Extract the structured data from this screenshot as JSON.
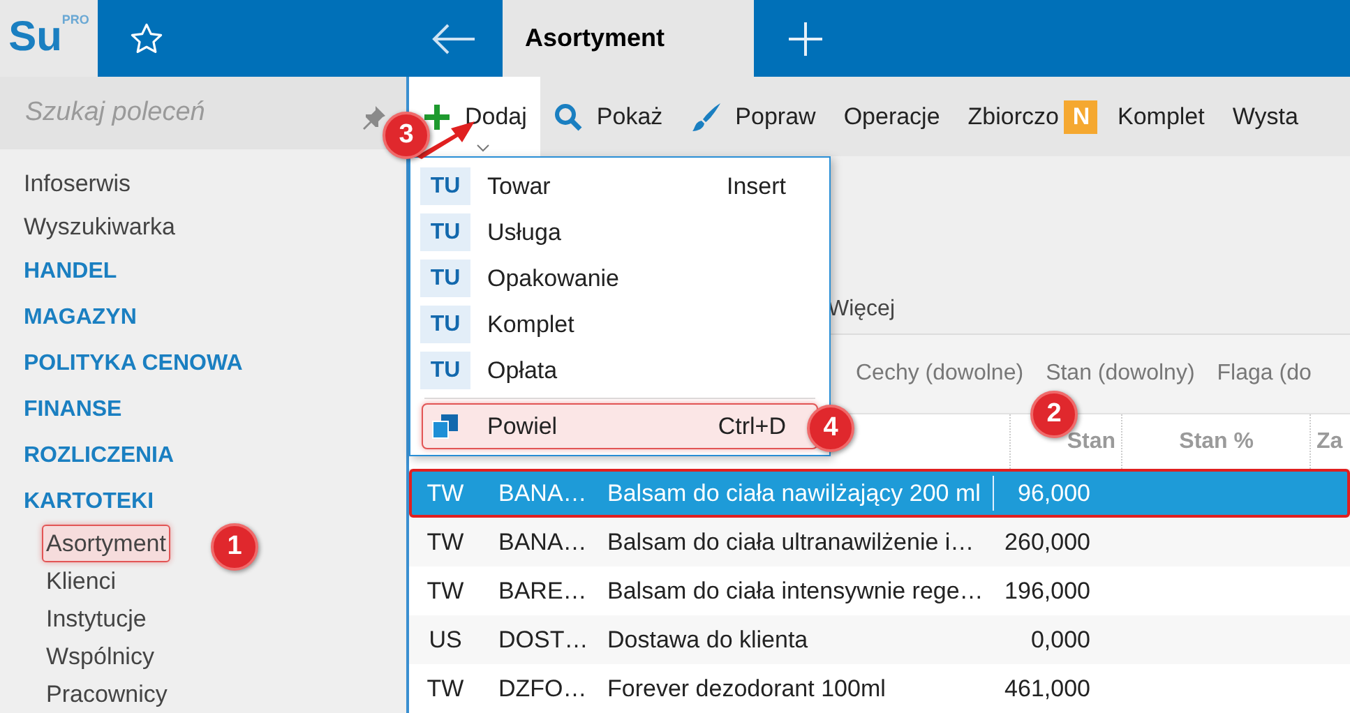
{
  "app": {
    "logo": "Su",
    "logo_badge": "PRO"
  },
  "tabs": [
    {
      "label": "Asortyment",
      "selected": true
    }
  ],
  "sidebar": {
    "search": {
      "placeholder": "Szukaj poleceń"
    },
    "items": [
      {
        "label": "Infoserwis",
        "kind": "link"
      },
      {
        "label": "Wyszukiwarka",
        "kind": "link"
      },
      {
        "label": "HANDEL",
        "kind": "section"
      },
      {
        "label": "MAGAZYN",
        "kind": "section"
      },
      {
        "label": "POLITYKA CENOWA",
        "kind": "section"
      },
      {
        "label": "FINANSE",
        "kind": "section"
      },
      {
        "label": "ROZLICZENIA",
        "kind": "section"
      },
      {
        "label": "KARTOTEKI",
        "kind": "section",
        "children": [
          {
            "label": "Asortyment",
            "selected": true
          },
          {
            "label": "Klienci",
            "selected": false
          },
          {
            "label": "Instytucje",
            "selected": false
          },
          {
            "label": "Wspólnicy",
            "selected": false
          },
          {
            "label": "Pracownicy",
            "selected": false
          }
        ]
      }
    ]
  },
  "toolbar": [
    {
      "label": "Dodaj",
      "kind": "add",
      "expanded": true
    },
    {
      "label": "Pokaż",
      "kind": "show",
      "expanded": false
    },
    {
      "label": "Popraw",
      "kind": "edit",
      "expanded": false
    },
    {
      "label": "Operacje",
      "kind": "plain",
      "expanded": false
    },
    {
      "label": "Zbiorczo",
      "kind": "plain",
      "badge": "N",
      "expanded": false
    },
    {
      "label": "Komplet",
      "kind": "plain",
      "expanded": false
    },
    {
      "label": "Wysta",
      "kind": "plain",
      "expanded": false
    }
  ],
  "more_label": "Więcej",
  "filters": [
    "Cechy (dowolne)",
    "Stan (dowolny)",
    "Flaga (do"
  ],
  "table": {
    "columns": [
      "Stan",
      "Stan %",
      "Za"
    ],
    "rows": [
      {
        "cells": [
          "TW",
          "BANA…",
          "Balsam do ciała nawilżający 200 ml",
          "96,000"
        ],
        "selected": true
      },
      {
        "cells": [
          "TW",
          "BANA…",
          "Balsam do ciała ultranawilżenie i…",
          "260,000"
        ],
        "selected": false
      },
      {
        "cells": [
          "TW",
          "BARE…",
          "Balsam do ciała intensywnie rege…",
          "196,000"
        ],
        "selected": false
      },
      {
        "cells": [
          "US",
          "DOST…",
          "Dostawa do klienta",
          "0,000"
        ],
        "selected": false
      },
      {
        "cells": [
          "TW",
          "DZFO…",
          "Forever dezodorant 100ml",
          "461,000"
        ],
        "selected": false
      }
    ]
  },
  "menu": {
    "items": [
      {
        "kind": "type",
        "icon_text": "TU",
        "label": "Towar",
        "shortcut": "Insert",
        "highlighted": false
      },
      {
        "kind": "type",
        "icon_text": "TU",
        "label": "Usługa",
        "highlighted": false
      },
      {
        "kind": "type",
        "icon_text": "TU",
        "label": "Opakowanie",
        "highlighted": false
      },
      {
        "kind": "type",
        "icon_text": "TU",
        "label": "Komplet",
        "highlighted": false
      },
      {
        "kind": "type",
        "icon_text": "TU",
        "label": "Opłata",
        "highlighted": false
      },
      {
        "kind": "action",
        "label": "Powiel",
        "shortcut": "Ctrl+D",
        "highlighted": true
      }
    ]
  },
  "annotations": [
    "1",
    "2",
    "3",
    "4"
  ]
}
